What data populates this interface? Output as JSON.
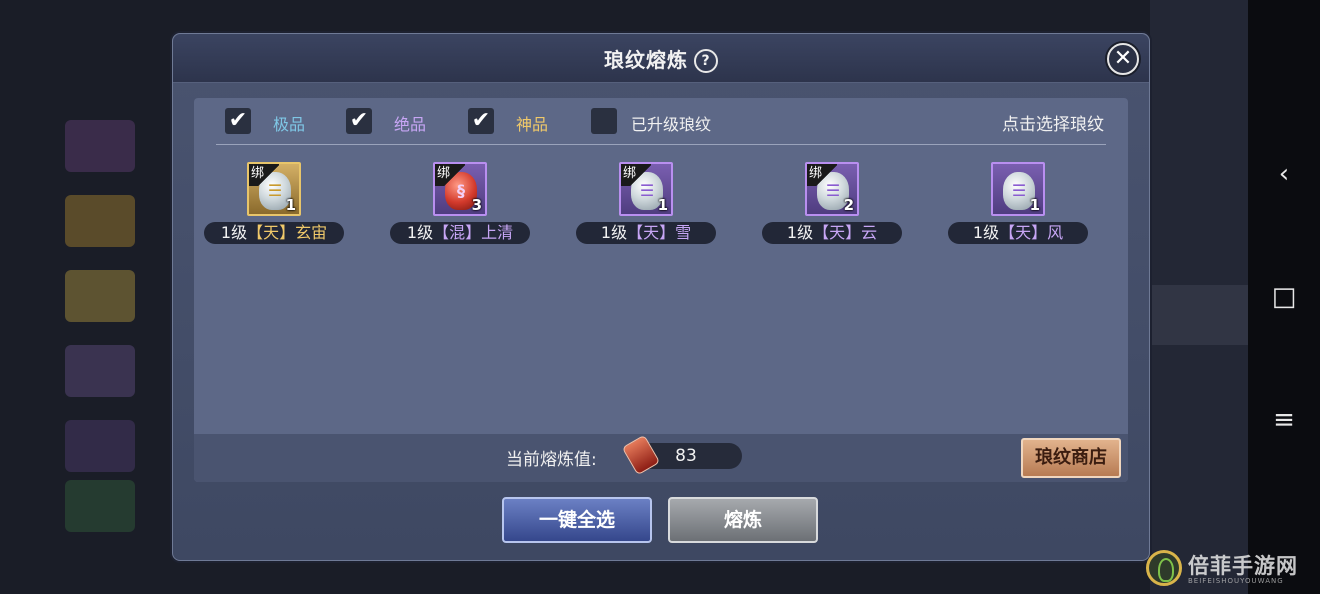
{
  "dialog": {
    "title": "琅纹熔炼",
    "help_glyph": "?",
    "close_glyph": "✕"
  },
  "filters": [
    {
      "label": "极品",
      "checked": true,
      "color": "#7fc7e6"
    },
    {
      "label": "绝品",
      "checked": true,
      "color": "#c7a6f5"
    },
    {
      "label": "神品",
      "checked": true,
      "color": "#f0c96a"
    },
    {
      "label": "已升级琅纹",
      "checked": false,
      "color": "#f0f0f0"
    }
  ],
  "hint": "点击选择琅纹",
  "items": [
    {
      "bind": "绑",
      "count": "1",
      "level": "1级",
      "tier": "【天】",
      "name": "玄宙",
      "frame": "gold",
      "gem": "silver",
      "mark": "☰",
      "tier_color": "#f0c96a"
    },
    {
      "bind": "绑",
      "count": "3",
      "level": "1级",
      "tier": "【混】",
      "name": "上清",
      "frame": "purple",
      "gem": "red",
      "mark": "§",
      "tier_color": "#c7a6f5"
    },
    {
      "bind": "绑",
      "count": "1",
      "level": "1级",
      "tier": "【天】",
      "name": "雪",
      "frame": "purple",
      "gem": "silver",
      "mark": "☰",
      "tier_color": "#c7a6f5"
    },
    {
      "bind": "绑",
      "count": "2",
      "level": "1级",
      "tier": "【天】",
      "name": "云",
      "frame": "purple",
      "gem": "silver",
      "mark": "☰",
      "tier_color": "#c7a6f5"
    },
    {
      "bind": "",
      "count": "1",
      "level": "1级",
      "tier": "【天】",
      "name": "风",
      "frame": "purple",
      "gem": "silver",
      "mark": "☰",
      "tier_color": "#c7a6f5"
    }
  ],
  "smelt": {
    "label": "当前熔炼值:",
    "value": "83"
  },
  "shop_button": "琅纹商店",
  "buttons": {
    "select_all": "一键全选",
    "smelt": "熔炼"
  },
  "nav": {
    "back": "‹",
    "home": "□",
    "recents": "≡"
  },
  "watermark": {
    "text": "倍菲手游网",
    "sub": "BEIFEISHOUYOUWANG"
  }
}
